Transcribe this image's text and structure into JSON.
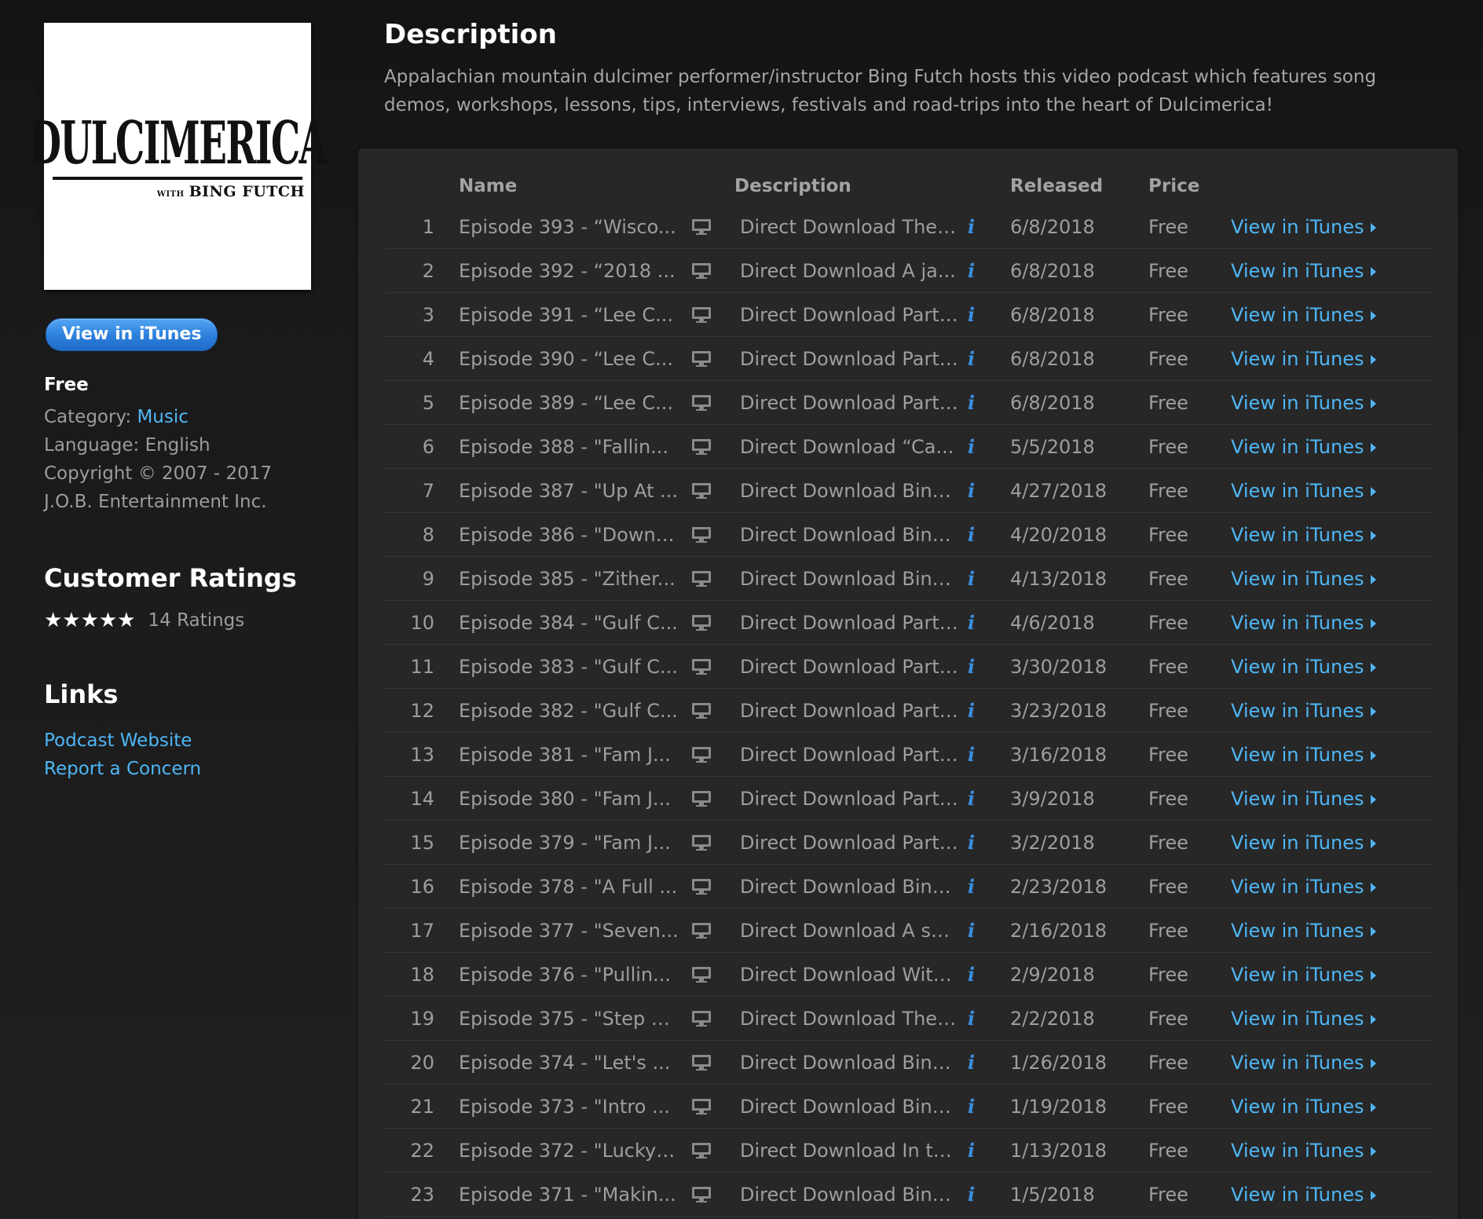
{
  "artwork": {
    "title": "DULCIMERICA",
    "with": "WITH",
    "host": "BING FUTCH"
  },
  "sidebar": {
    "view_button": "View in iTunes",
    "price": "Free",
    "category_label": "Category: ",
    "category_value": "Music",
    "language": "Language: English",
    "copyright_line1": "Copyright © 2007 - 2017",
    "copyright_line2": "J.O.B. Entertainment Inc.",
    "ratings_title": "Customer Ratings",
    "stars": "★★★★★",
    "stars_value": 5,
    "ratings_count": "14 Ratings",
    "links_title": "Links",
    "links": [
      "Podcast Website",
      "Report a Concern"
    ]
  },
  "description": {
    "heading": "Description",
    "text": "Appalachian mountain dulcimer performer/instructor Bing Futch hosts this video podcast which features song demos, workshops, lessons, tips, interviews, festivals and road-trips into the heart of Dulcimerica!"
  },
  "table": {
    "headers": {
      "name": "Name",
      "description": "Description",
      "released": "Released",
      "price": "Price"
    },
    "view_label": "View in iTunes",
    "rows": [
      {
        "num": "1",
        "name": "Episode 393 - “Wisco...",
        "desc": "Direct Download The ...",
        "date": "6/8/2018",
        "price": "Free"
      },
      {
        "num": "2",
        "name": "Episode 392 - “2018 ...",
        "desc": "Direct Download A ja...",
        "date": "6/8/2018",
        "price": "Free"
      },
      {
        "num": "3",
        "name": "Episode 391 - “Lee C...",
        "desc": "Direct Download Part ...",
        "date": "6/8/2018",
        "price": "Free"
      },
      {
        "num": "4",
        "name": "Episode 390 - “Lee C...",
        "desc": "Direct Download Part ...",
        "date": "6/8/2018",
        "price": "Free"
      },
      {
        "num": "5",
        "name": "Episode 389 - “Lee C...",
        "desc": "Direct Download Part ...",
        "date": "6/8/2018",
        "price": "Free"
      },
      {
        "num": "6",
        "name": "Episode 388 - \"Fallin...",
        "desc": "Direct Download “Ca...",
        "date": "5/5/2018",
        "price": "Free"
      },
      {
        "num": "7",
        "name": "Episode 387 - \"Up At ...",
        "desc": "Direct Download Bing...",
        "date": "4/27/2018",
        "price": "Free"
      },
      {
        "num": "8",
        "name": "Episode 386 - \"Down ...",
        "desc": "Direct Download Bing...",
        "date": "4/20/2018",
        "price": "Free"
      },
      {
        "num": "9",
        "name": "Episode 385 - \"Zither...",
        "desc": "Direct Download Bing...",
        "date": "4/13/2018",
        "price": "Free"
      },
      {
        "num": "10",
        "name": "Episode 384 - \"Gulf C...",
        "desc": "Direct Download Part ...",
        "date": "4/6/2018",
        "price": "Free"
      },
      {
        "num": "11",
        "name": "Episode 383 - \"Gulf C...",
        "desc": "Direct Download Part ...",
        "date": "3/30/2018",
        "price": "Free"
      },
      {
        "num": "12",
        "name": "Episode 382 - \"Gulf C...",
        "desc": "Direct Download Part ...",
        "date": "3/23/2018",
        "price": "Free"
      },
      {
        "num": "13",
        "name": "Episode 381 - \"Fam J...",
        "desc": "Direct Download Part ...",
        "date": "3/16/2018",
        "price": "Free"
      },
      {
        "num": "14",
        "name": "Episode 380 - \"Fam J...",
        "desc": "Direct Download Part ...",
        "date": "3/9/2018",
        "price": "Free"
      },
      {
        "num": "15",
        "name": "Episode 379 - \"Fam J...",
        "desc": "Direct Download Part ...",
        "date": "3/2/2018",
        "price": "Free"
      },
      {
        "num": "16",
        "name": "Episode 378 - \"A Full ...",
        "desc": "Direct Download Bing...",
        "date": "2/23/2018",
        "price": "Free"
      },
      {
        "num": "17",
        "name": "Episode 377 - \"Seven...",
        "desc": "Direct Download A sp...",
        "date": "2/16/2018",
        "price": "Free"
      },
      {
        "num": "18",
        "name": "Episode 376 - \"Pullin...",
        "desc": "Direct Download With...",
        "date": "2/9/2018",
        "price": "Free"
      },
      {
        "num": "19",
        "name": "Episode 375 - \"Step B...",
        "desc": "Direct Download The ...",
        "date": "2/2/2018",
        "price": "Free"
      },
      {
        "num": "20",
        "name": "Episode 374 - \"Let's ...",
        "desc": "Direct Download Bing...",
        "date": "1/26/2018",
        "price": "Free"
      },
      {
        "num": "21",
        "name": "Episode 373 - \"Intro ...",
        "desc": "Direct Download Bing...",
        "date": "1/19/2018",
        "price": "Free"
      },
      {
        "num": "22",
        "name": "Episode 372 - \"Lucky ...",
        "desc": "Direct Download In th...",
        "date": "1/13/2018",
        "price": "Free"
      },
      {
        "num": "23",
        "name": "Episode 371 - \"Makin...",
        "desc": "Direct Download Bing...",
        "date": "1/5/2018",
        "price": "Free"
      }
    ]
  },
  "colors": {
    "link": "#4fb6f5",
    "button": "#2c7fdb",
    "info_icon": "#3a8fe0",
    "background": "#1b1b1b",
    "panel": "#272727"
  },
  "icons": {
    "video": "video-monitor-icon",
    "info": "info-icon",
    "arrow": "chevron-right-icon"
  }
}
